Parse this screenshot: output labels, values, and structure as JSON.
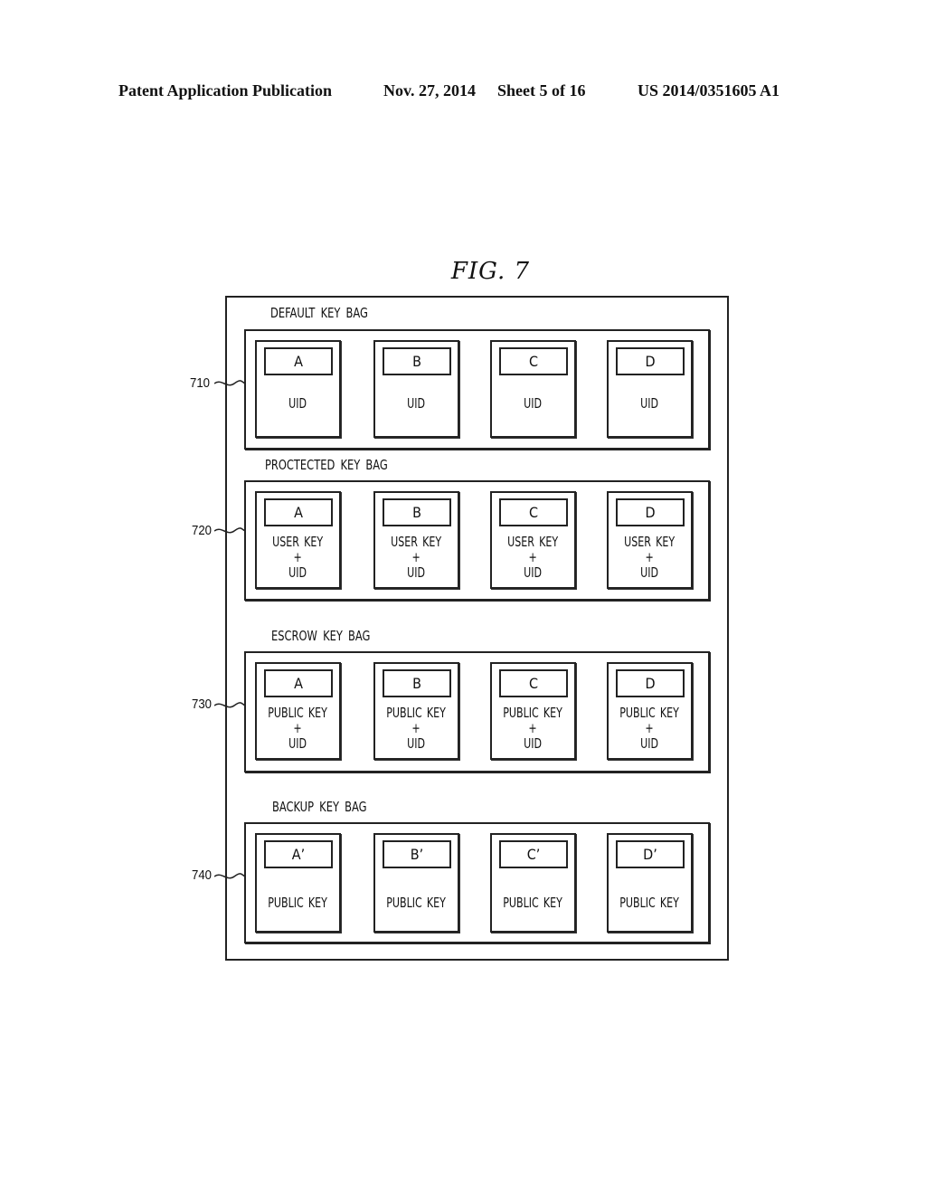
{
  "header": {
    "publication": "Patent Application Publication",
    "date": "Nov. 27, 2014",
    "sheet": "Sheet 5 of 16",
    "number": "US 2014/0351605 A1"
  },
  "figure": {
    "title": "FIG. 7",
    "bags": [
      {
        "ref": "710",
        "label": "DEFAULT KEY BAG",
        "keys": [
          {
            "id": "A",
            "content": "UID"
          },
          {
            "id": "B",
            "content": "UID"
          },
          {
            "id": "C",
            "content": "UID"
          },
          {
            "id": "D",
            "content": "UID"
          }
        ]
      },
      {
        "ref": "720",
        "label": "PROCTECTED KEY BAG",
        "keys": [
          {
            "id": "A",
            "content": "USER KEY\n+\nUID"
          },
          {
            "id": "B",
            "content": "USER KEY\n+\nUID"
          },
          {
            "id": "C",
            "content": "USER KEY\n+\nUID"
          },
          {
            "id": "D",
            "content": "USER KEY\n+\nUID"
          }
        ]
      },
      {
        "ref": "730",
        "label": "ESCROW KEY BAG",
        "keys": [
          {
            "id": "A",
            "content": "PUBLIC KEY\n+\nUID"
          },
          {
            "id": "B",
            "content": "PUBLIC KEY\n+\nUID"
          },
          {
            "id": "C",
            "content": "PUBLIC KEY\n+\nUID"
          },
          {
            "id": "D",
            "content": "PUBLIC KEY\n+\nUID"
          }
        ]
      },
      {
        "ref": "740",
        "label": "BACKUP KEY BAG",
        "keys": [
          {
            "id": "A’",
            "content": "PUBLIC KEY"
          },
          {
            "id": "B’",
            "content": "PUBLIC KEY"
          },
          {
            "id": "C’",
            "content": "PUBLIC KEY"
          },
          {
            "id": "D’",
            "content": "PUBLIC KEY"
          }
        ]
      }
    ]
  }
}
